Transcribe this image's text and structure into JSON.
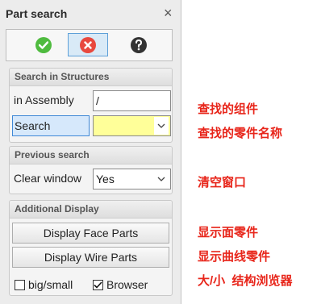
{
  "panel": {
    "title": "Part search",
    "close_symbol": "×",
    "toolbar": {
      "ok_icon": "green-check-icon",
      "cancel_icon": "red-x-icon",
      "help_icon": "question-mark-icon"
    }
  },
  "search_structures": {
    "header": "Search in Structures",
    "assembly_label": "in Assembly",
    "assembly_value": "/",
    "search_label": "Search",
    "search_value": ""
  },
  "previous_search": {
    "header": "Previous search",
    "clear_label": "Clear window",
    "clear_value": "Yes"
  },
  "additional_display": {
    "header": "Additional Display",
    "face_button": "Display Face Parts",
    "wire_button": "Display Wire Parts",
    "bigsmall_label": "big/small",
    "bigsmall_checked": false,
    "browser_label": "Browser",
    "browser_checked": true
  },
  "annotations": {
    "find_assembly": "查找的组件",
    "find_part_name": "查找的零件名称",
    "clear_window": "清空窗口",
    "show_face_parts": "显示面零件",
    "show_wire_parts": "显示曲线零件",
    "size_browser": "大/小  结构浏览器"
  },
  "colors": {
    "accent_red": "#e8261b",
    "ok_green": "#4fbb3f",
    "cancel_red": "#e8483e",
    "highlight_yellow": "#ffff99",
    "focus_blue": "#3f88d6"
  }
}
